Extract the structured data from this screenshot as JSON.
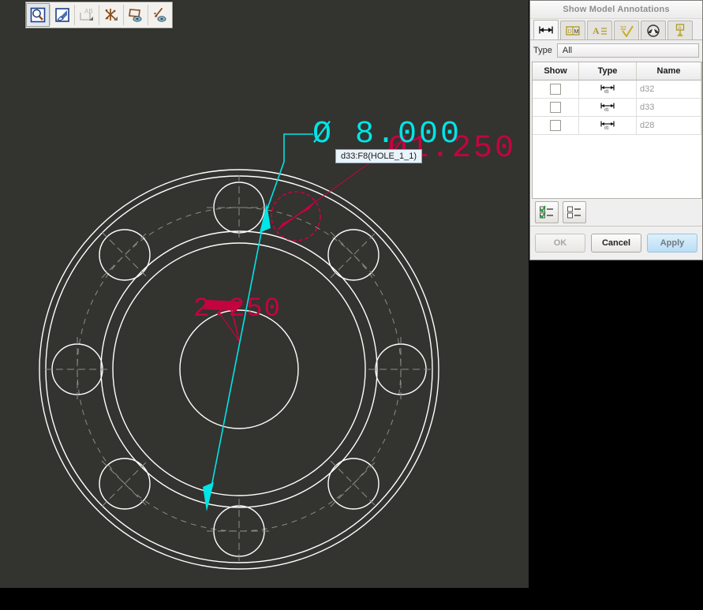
{
  "toolbar": {
    "buttons": [
      {
        "name": "zoom-in-icon",
        "label": "Zoom In",
        "selected": true
      },
      {
        "name": "repaint-icon",
        "label": "Repaint",
        "selected": false
      },
      {
        "name": "annotation-display-icon",
        "label": "Annotation Display",
        "selected": false
      },
      {
        "name": "datum-display-icon",
        "label": "Datum Display",
        "selected": false
      },
      {
        "name": "spin-center-icon",
        "label": "Spin Center",
        "selected": false
      },
      {
        "name": "display-style-icon",
        "label": "Display Style",
        "selected": false
      }
    ]
  },
  "dialog": {
    "title": "Show Model Annotations",
    "tabs": [
      {
        "name": "tab-dimensions",
        "icon": "dimension-icon",
        "active": true
      },
      {
        "name": "tab-notes",
        "icon": "note-icon",
        "active": false
      },
      {
        "name": "tab-text-annotations",
        "icon": "text-annotation-icon",
        "active": false
      },
      {
        "name": "tab-surface-finish",
        "icon": "surface-finish-icon",
        "active": false
      },
      {
        "name": "tab-geometric-tolerance",
        "icon": "gtol-icon",
        "active": false
      },
      {
        "name": "tab-datums",
        "icon": "datum-icon",
        "active": false
      }
    ],
    "type_label": "Type",
    "type_value": "All",
    "table": {
      "columns": [
        "Show",
        "Type",
        "Name"
      ],
      "rows": [
        {
          "show": false,
          "type_icon": "dimension-row-icon",
          "name": "d32"
        },
        {
          "show": false,
          "type_icon": "dimension-row-icon",
          "name": "d33"
        },
        {
          "show": false,
          "type_icon": "dimension-row-icon",
          "name": "d28"
        }
      ]
    },
    "tool_buttons": [
      {
        "name": "select-all-button",
        "icon": "checked-list-icon"
      },
      {
        "name": "deselect-all-button",
        "icon": "unchecked-list-icon"
      }
    ],
    "buttons": {
      "ok": "OK",
      "cancel": "Cancel",
      "apply": "Apply"
    }
  },
  "drawing": {
    "tooltip": "d33:F8(HOLE_1_1)",
    "selected_dimension": "Ø 8.000",
    "other_dimension": "Ø1.250",
    "inner_dimension": "2.250",
    "colors": {
      "background": "#333330",
      "geometry": "#ffffff",
      "hidden": "#8c8c86",
      "selected": "#00e5e5",
      "highlight": "#c4043f"
    }
  }
}
